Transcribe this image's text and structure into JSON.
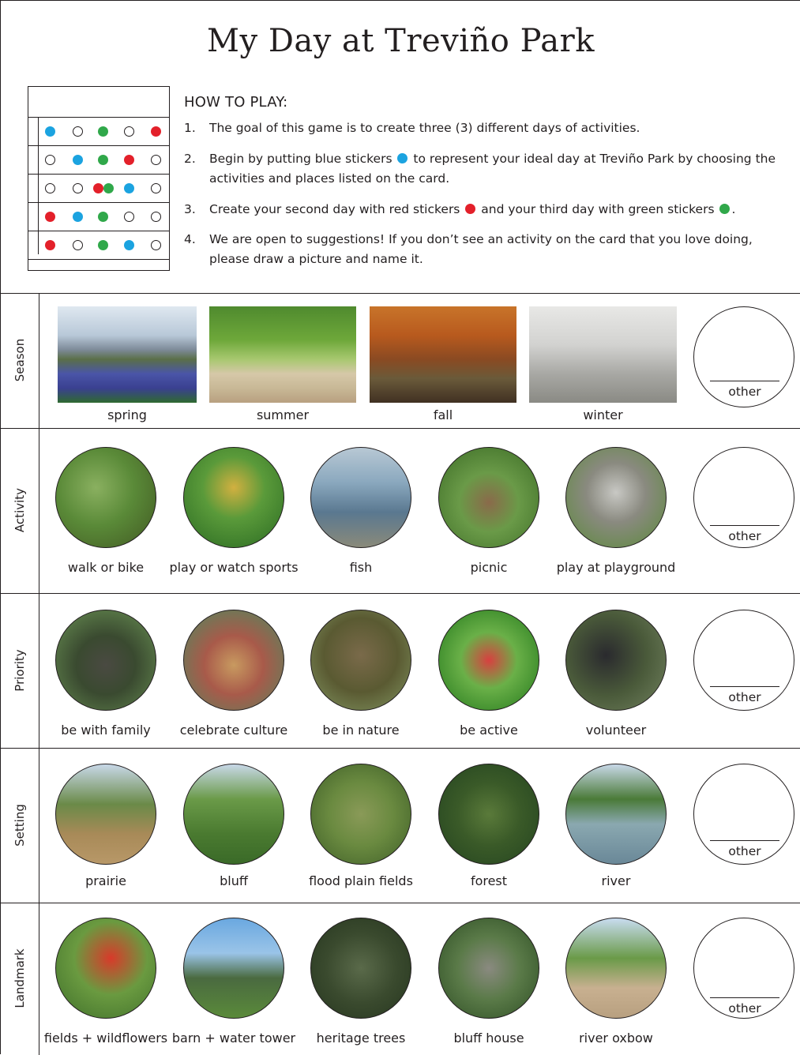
{
  "title": "My Day at Treviño Park",
  "howto": {
    "heading": "HOW TO PLAY:",
    "steps": [
      {
        "num": "1.",
        "text": "The goal of this game is to create three (3) different days of activities."
      },
      {
        "num": "2.",
        "text_a": "Begin by putting blue stickers",
        "text_b": "to represent your ideal day at Treviño Park by choosing the activities and places listed on the card."
      },
      {
        "num": "3.",
        "text_a": "Create your second day with red stickers",
        "text_b": "and your third day with green stickers",
        "text_c": "."
      },
      {
        "num": "4.",
        "text": "We are open to suggestions! If you don’t see an activity on the card that you love doing, please draw a picture and name it."
      }
    ]
  },
  "colors": {
    "blue": "#1ba3e0",
    "red": "#e3202a",
    "green": "#30a84a"
  },
  "example_card": [
    [
      "blue",
      "empty",
      "green",
      "empty",
      "red"
    ],
    [
      "empty",
      "blue",
      "green",
      "red",
      "empty"
    ],
    [
      "empty",
      "empty",
      "red+green",
      "blue",
      "empty"
    ],
    [
      "red",
      "blue",
      "green",
      "empty",
      "empty"
    ],
    [
      "red",
      "empty",
      "green",
      "blue",
      "empty"
    ]
  ],
  "categories": [
    {
      "label": "Season",
      "items": [
        "spring",
        "summer",
        "fall",
        "winter"
      ],
      "other": "other"
    },
    {
      "label": "Activity",
      "items": [
        "walk or bike",
        "play or watch sports",
        "fish",
        "picnic",
        "play at playground"
      ],
      "other": "other"
    },
    {
      "label": "Priority",
      "items": [
        "be with family",
        "celebrate culture",
        "be in nature",
        "be active",
        "volunteer"
      ],
      "other": "other"
    },
    {
      "label": "Setting",
      "items": [
        "prairie",
        "bluff",
        "flood plain fields",
        "forest",
        "river"
      ],
      "other": "other"
    },
    {
      "label": "Landmark",
      "items": [
        "fields + wildflowers",
        "barn + water tower",
        "heritage trees",
        "bluff house",
        "river oxbow"
      ],
      "other": "other"
    }
  ]
}
